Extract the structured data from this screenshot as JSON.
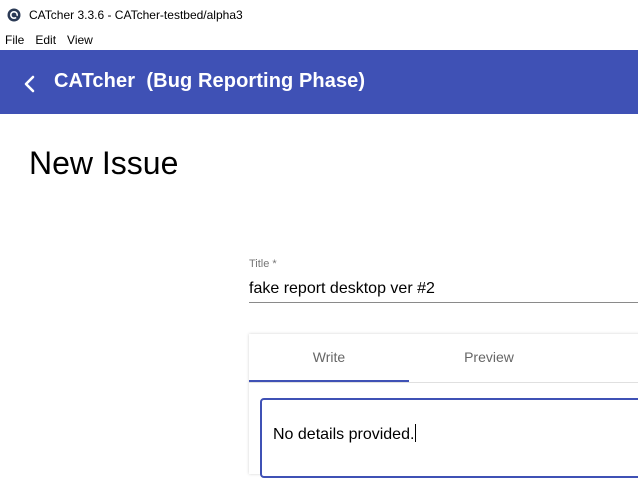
{
  "window": {
    "title": "CATcher 3.3.6 - CATcher-testbed/alpha3",
    "icon": "catcher-app-icon"
  },
  "menubar": {
    "items": [
      {
        "label": "File"
      },
      {
        "label": "Edit"
      },
      {
        "label": "View"
      }
    ]
  },
  "appbar": {
    "title": "CATcher  (Bug Reporting Phase)",
    "back_icon": "chevron-left-icon",
    "background": "#3f51b5"
  },
  "page": {
    "title": "New Issue"
  },
  "form": {
    "title_label": "Title *",
    "title_value": "fake report desktop ver #2",
    "tabs": [
      {
        "label": "Write",
        "active": true
      },
      {
        "label": "Preview",
        "active": false
      }
    ],
    "description_value": "No details provided."
  },
  "colors": {
    "accent": "#3f51b5",
    "label_gray": "#757575"
  }
}
